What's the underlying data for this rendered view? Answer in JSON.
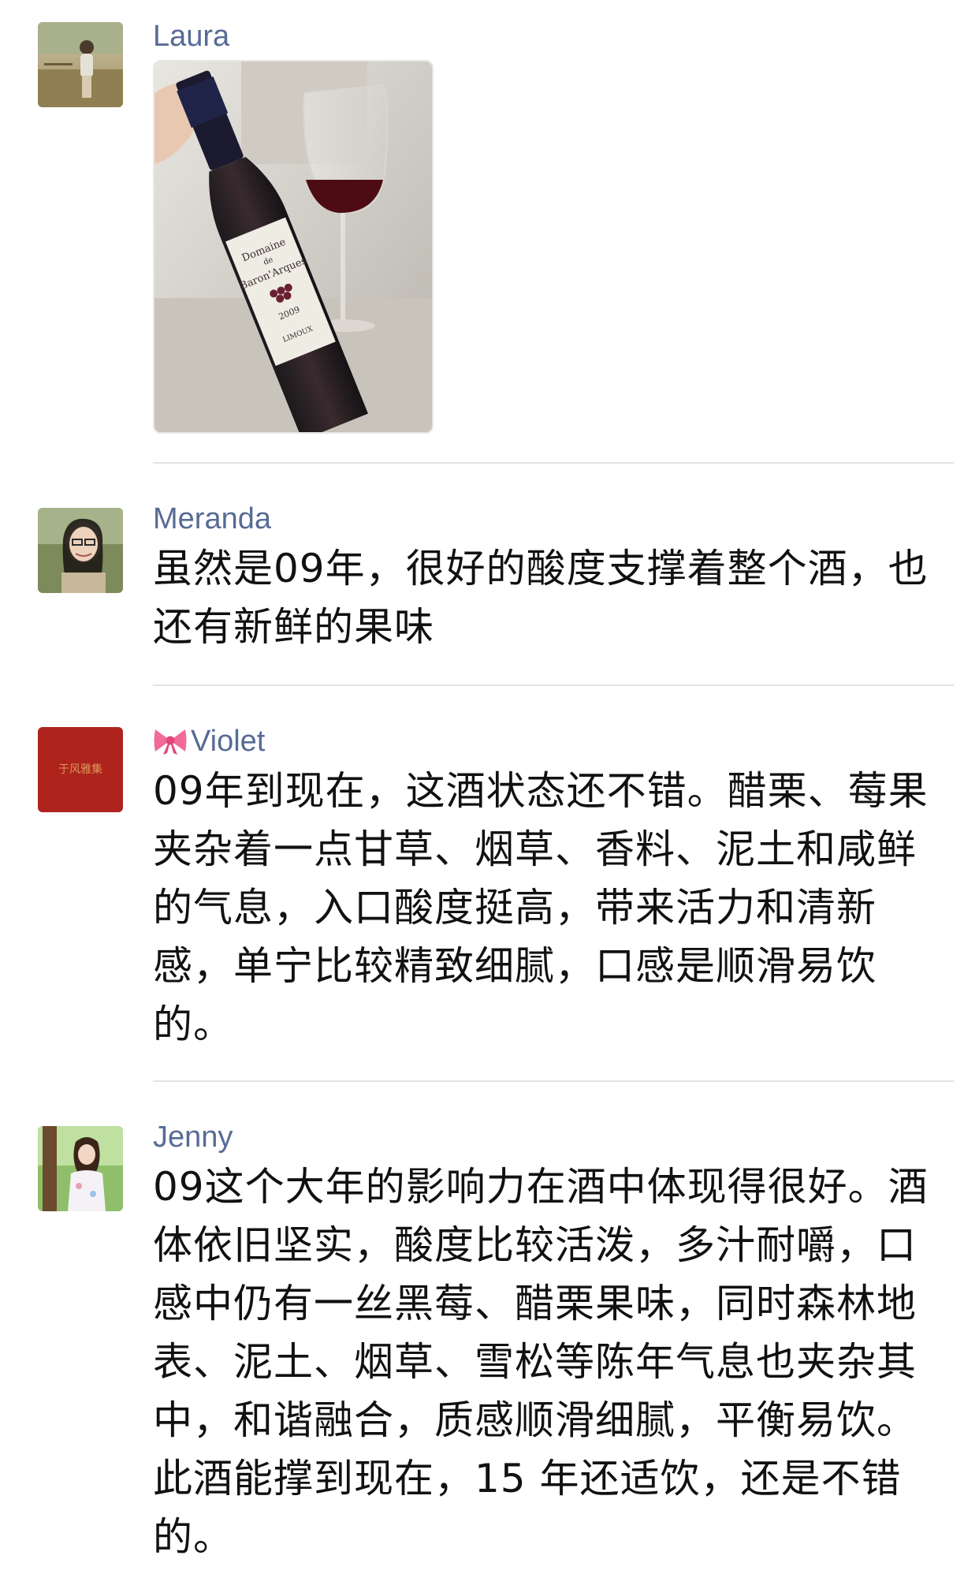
{
  "comments": [
    {
      "username": "Laura",
      "type": "image",
      "image": {
        "label_line1": "Domaine",
        "label_line2": "de",
        "label_line3": "Baron'Arques",
        "vintage": "2009",
        "region": "LIMOUX"
      }
    },
    {
      "username": "Meranda",
      "type": "text",
      "text": "虽然是09年，很好的酸度支撑着整个酒，也还有新鲜的果味"
    },
    {
      "username": "Violet",
      "username_prefix_icon": "bow-emoji-icon",
      "type": "text",
      "text": "09年到现在，这酒状态还不错。醋栗、莓果夹杂着一点甘草、烟草、香料、泥土和咸鲜的气息，入口酸度挺高，带来活力和清新感，单宁比较精致细腻，口感是顺滑易饮的。"
    },
    {
      "username": "Jenny",
      "type": "text",
      "text": "09这个大年的影响力在酒中体现得很好。酒体依旧坚实，酸度比较活泼，多汁耐嚼，口感中仍有一丝黑莓、醋栗果味，同时森林地表、泥土、烟草、雪松等陈年气息也夹杂其中，和谐融合，质感顺滑细腻，平衡易饮。此酒能撑到现在，15 年还适饮，还是不错的。"
    }
  ],
  "colors": {
    "username": "#576b95",
    "text": "#111111",
    "divider": "#e3e3e3"
  }
}
